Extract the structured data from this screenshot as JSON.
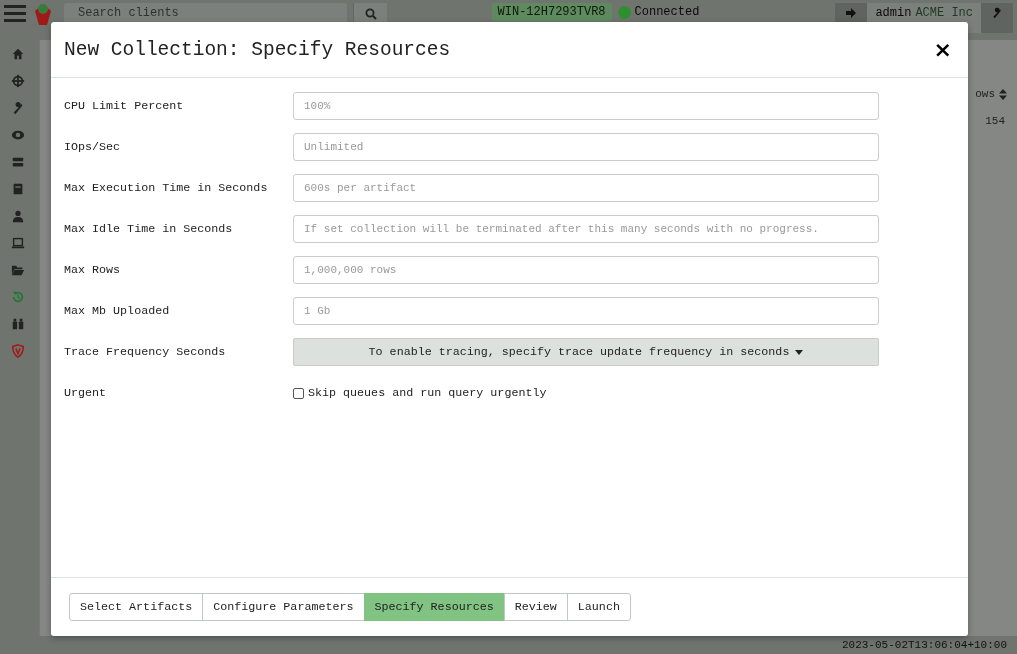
{
  "app": {
    "search": {
      "placeholder": "Search clients"
    },
    "host": "WIN-12H7293TVR8",
    "connection": {
      "label": "Connected",
      "connected": true
    },
    "user": "admin",
    "org": "ACME Inc"
  },
  "background_table": {
    "column_header": "ows",
    "cell": "154"
  },
  "status_bar": {
    "timestamp": "2023-05-02T13:06:04+10:00"
  },
  "modal": {
    "title": "New Collection: Specify Resources",
    "close": "×",
    "fields": [
      {
        "kind": "input",
        "label": "CPU Limit Percent",
        "placeholder": "100%"
      },
      {
        "kind": "input",
        "label": "IOps/Sec",
        "placeholder": "Unlimited"
      },
      {
        "kind": "input",
        "label": "Max Execution Time in Seconds",
        "placeholder": "600s per artifact"
      },
      {
        "kind": "input",
        "label": "Max Idle Time in Seconds",
        "placeholder": "If set collection will be terminated after this many seconds with no progress."
      },
      {
        "kind": "input",
        "label": "Max Rows",
        "placeholder": "1,000,000 rows"
      },
      {
        "kind": "input",
        "label": "Max Mb Uploaded",
        "placeholder": "1 Gb"
      },
      {
        "kind": "dropdown",
        "label": "Trace Frequency Seconds",
        "value": "To enable tracing, specify trace update frequency in seconds"
      },
      {
        "kind": "checkbox",
        "label": "Urgent",
        "text": "Skip queues and run query urgently",
        "checked": false
      }
    ],
    "steps": [
      {
        "label": "Select Artifacts",
        "selected": false
      },
      {
        "label": "Configure Parameters",
        "selected": false
      },
      {
        "label": "Specify Resources",
        "selected": true
      },
      {
        "label": "Review",
        "selected": false
      },
      {
        "label": "Launch",
        "selected": false
      }
    ]
  }
}
